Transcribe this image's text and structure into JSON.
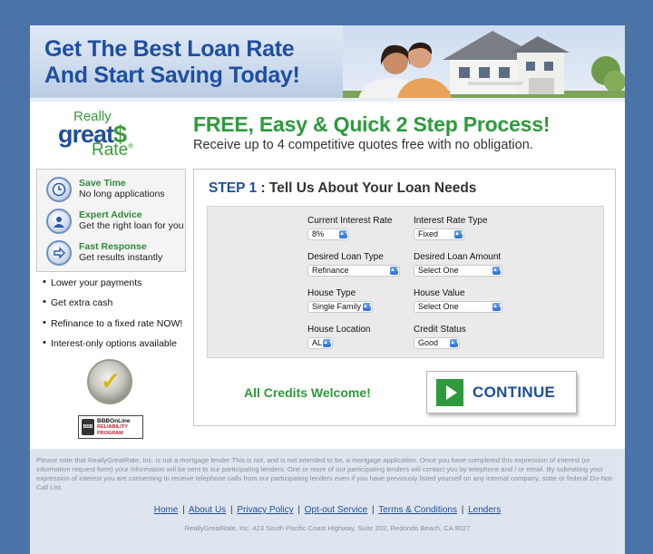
{
  "banner": {
    "headline_line1": "Get The Best Loan Rate",
    "headline_line2": "And Start Saving Today!"
  },
  "logo": {
    "line1": "Really",
    "line2": "great",
    "dollar": "$",
    "line3": "Rate",
    "mark": "®"
  },
  "tagline": {
    "title": "FREE, Easy & Quick 2 Step Process!",
    "subtitle": "Receive up to 4 competitive quotes free with no obligation."
  },
  "benefits": [
    {
      "title": "Save Time",
      "subtitle": "No long applications",
      "icon": "clock-icon"
    },
    {
      "title": "Expert Advice",
      "subtitle": "Get the right loan for you",
      "icon": "advisor-icon"
    },
    {
      "title": "Fast Response",
      "subtitle": "Get results instantly",
      "icon": "arrow-right-icon"
    }
  ],
  "bullets": [
    "Lower your payments",
    "Get extra cash",
    "Refinance to a fixed rate NOW!",
    "Interest-only options available"
  ],
  "bbb": {
    "line1": "BBBOnLine",
    "line2": "RELIABILITY",
    "line3": "PROGRAM",
    "badge": "BBB"
  },
  "form": {
    "step_number": "STEP 1",
    "step_sep": " : ",
    "step_title": "Tell Us About Your Loan Needs",
    "fields": {
      "current_rate": {
        "label": "Current Interest Rate",
        "value": "8%"
      },
      "rate_type": {
        "label": "Interest Rate Type",
        "value": "Fixed"
      },
      "loan_type": {
        "label": "Desired Loan Type",
        "value": "Refinance"
      },
      "loan_amount": {
        "label": "Desired Loan Amount",
        "value": "Select One"
      },
      "house_type": {
        "label": "House Type",
        "value": "Single Family"
      },
      "house_value": {
        "label": "House Value",
        "value": "Select One"
      },
      "house_location": {
        "label": "House Location",
        "value": "AL"
      },
      "credit_status": {
        "label": "Credit Status",
        "value": "Good"
      }
    },
    "credits_text": "All Credits Welcome!",
    "continue_label": "CONTINUE"
  },
  "footer": {
    "disclaimer": "Please note that ReallyGreatRate, Inc. is not a mortgage lender This is not, and is not intended to be, a mortgage application. Once you have completed this expression of interest (or information request form) your information will be sent to our participating lenders. One or more of our participating lenders will contact you by telephone and / or email. By submitting your expression of interest you are consenting to receive telephone calls from our participating lenders even if you have previously listed yourself on any internal company, state or federal Do-Not-Call List.",
    "links": [
      "Home",
      "About Us",
      "Privacy Policy",
      "Opt-out Service",
      "Terms & Conditions",
      "Lenders"
    ],
    "separator": "|",
    "address": "ReallyGreatRate, Inc. 423 South Pacific Coast Highway, Suite 202, Redondo Beach, CA 9027"
  },
  "colors": {
    "background": "#4a73a8",
    "brand_blue": "#1f4f9a",
    "brand_green": "#2e9a3c"
  }
}
